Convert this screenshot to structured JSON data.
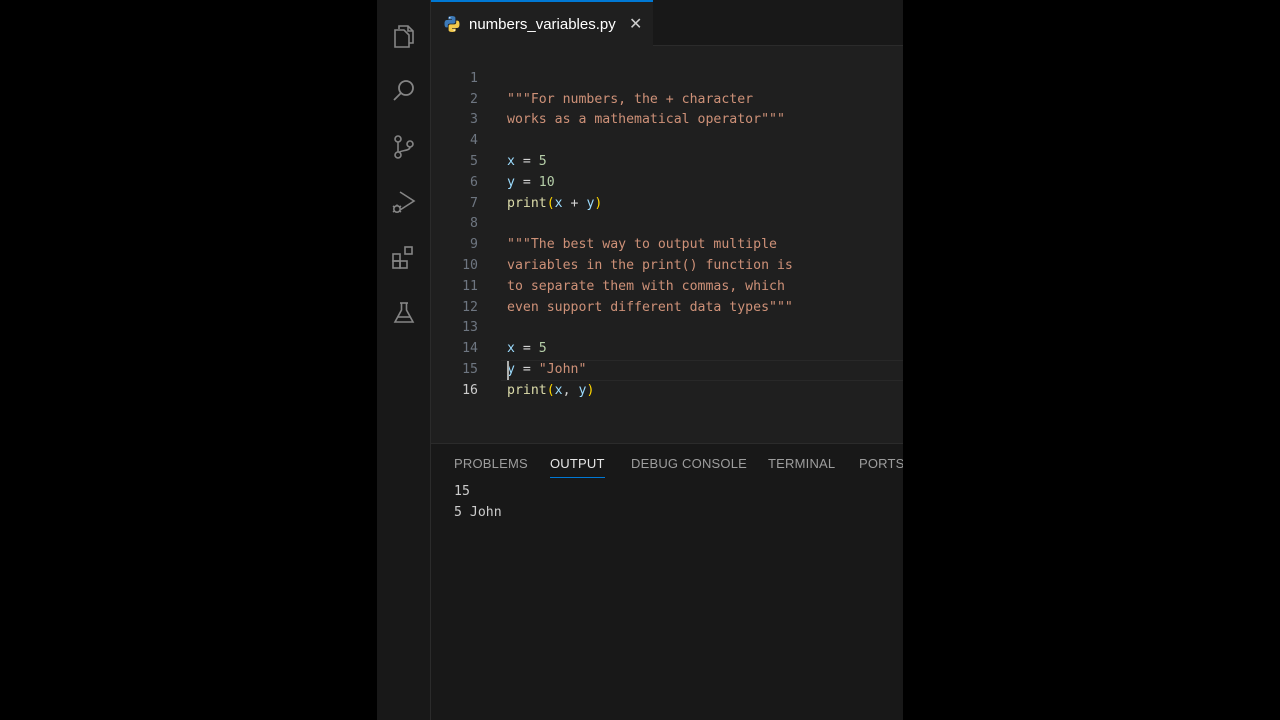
{
  "editor": {
    "tab_title": "numbers_variables.py",
    "tab_close": "✕",
    "line_numbers": [
      "1",
      "2",
      "3",
      "4",
      "5",
      "6",
      "7",
      "8",
      "9",
      "10",
      "11",
      "12",
      "13",
      "14",
      "15",
      "16"
    ]
  },
  "code": {
    "l1_str": "\"\"\"For numbers, the + character",
    "l2_str": "works as a mathematical operator\"\"\"",
    "l4_var": "x",
    "l4_op": " = ",
    "l4_num": "5",
    "l5_var": "y",
    "l5_op": " = ",
    "l5_num": "10",
    "l6_fn": "print",
    "l6_open": "(",
    "l6_a": "x",
    "l6_op": " + ",
    "l6_b": "y",
    "l6_close": ")",
    "l8_str": "\"\"\"The best way to output multiple",
    "l9_str": "variables in the print() function is",
    "l10_str": "to separate them with commas, which",
    "l11_str": "even support different data types\"\"\"",
    "l13_var": "x",
    "l13_op": " = ",
    "l13_num": "5",
    "l14_var": "y",
    "l14_op": " = ",
    "l14_str": "\"John\"",
    "l15_fn": "print",
    "l15_open": "(",
    "l15_a": "x",
    "l15_sep": ", ",
    "l15_b": "y",
    "l15_close": ")"
  },
  "panel": {
    "tabs": [
      "PROBLEMS",
      "OUTPUT",
      "DEBUG CONSOLE",
      "TERMINAL",
      "PORTS"
    ],
    "active_tab": "OUTPUT",
    "output_lines": [
      "15",
      "5 John"
    ]
  },
  "icons": {
    "activity_bar": [
      "explorer-icon",
      "search-icon",
      "source-control-icon",
      "run-debug-icon",
      "extensions-icon",
      "testing-icon"
    ],
    "tab": "python-file-icon"
  },
  "colors": {
    "accent": "#0078d4",
    "string": "#ce9178",
    "variable": "#9cdcfe",
    "number": "#b5cea8",
    "function": "#dcdcaa",
    "bracket": "#ffd700"
  }
}
